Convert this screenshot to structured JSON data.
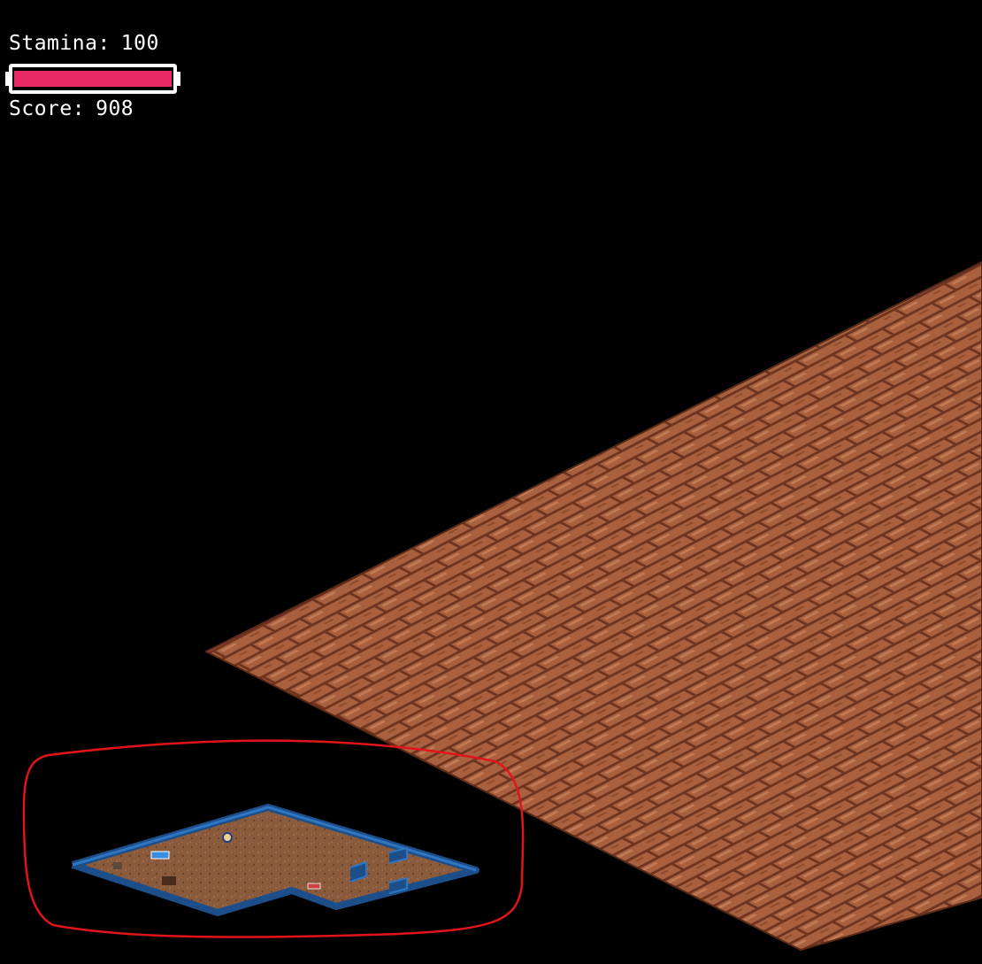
{
  "hud": {
    "stamina_label": "Stamina:",
    "stamina_value": "100",
    "stamina_fraction": 1.0,
    "stamina_color": "#ea2a65",
    "score_label": "Score:",
    "score_value": "908"
  },
  "scene": {
    "floor_color": "#a8603e",
    "brick_line_color": "#6e3420",
    "wall_color": "#1c4f8a",
    "annotation_color": "#e0141a"
  }
}
